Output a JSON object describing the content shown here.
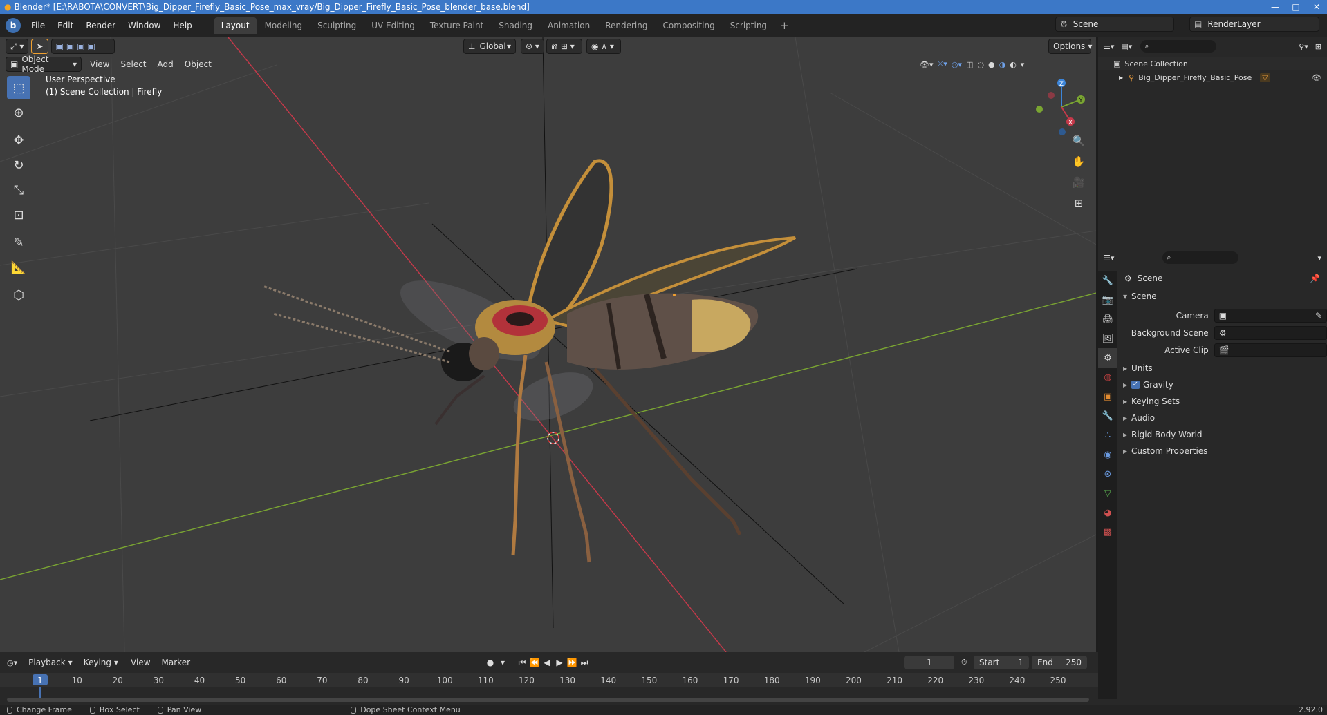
{
  "window": {
    "title": "Blender* [E:\\RABOTA\\CONVERT\\Big_Dipper_Firefly_Basic_Pose_max_vray/Big_Dipper_Firefly_Basic_Pose_blender_base.blend]",
    "minimize": "—",
    "maximize": "□",
    "close": "✕"
  },
  "menu": [
    "File",
    "Edit",
    "Render",
    "Window",
    "Help"
  ],
  "workspaces": [
    "Layout",
    "Modeling",
    "Sculpting",
    "UV Editing",
    "Texture Paint",
    "Shading",
    "Animation",
    "Rendering",
    "Compositing",
    "Scripting"
  ],
  "active_workspace": "Layout",
  "scene_name": "Scene",
  "view_layer": "RenderLayer",
  "viewport": {
    "transform_orientation": "Global",
    "options_label": "Options",
    "mode": "Object Mode",
    "menus": [
      "View",
      "Select",
      "Add",
      "Object"
    ],
    "overlay_line1": "User Perspective",
    "overlay_line2": "(1) Scene Collection | Firefly",
    "gizmo": {
      "x": "X",
      "y": "Y",
      "z": "Z"
    }
  },
  "outliner": {
    "collection": "Scene Collection",
    "object": "Big_Dipper_Firefly_Basic_Pose"
  },
  "properties": {
    "context_title": "Scene",
    "panel_title": "Scene",
    "camera_label": "Camera",
    "bg_scene_label": "Background Scene",
    "active_clip_label": "Active Clip",
    "sections": [
      "Units",
      "Gravity",
      "Keying Sets",
      "Audio",
      "Rigid Body World",
      "Custom Properties"
    ],
    "gravity_checked": true
  },
  "timeline": {
    "menus": [
      "Playback",
      "Keying",
      "View",
      "Marker"
    ],
    "current_frame": "1",
    "start_label": "Start",
    "start_value": "1",
    "end_label": "End",
    "end_value": "250",
    "ruler": [
      "1",
      "10",
      "20",
      "30",
      "40",
      "50",
      "60",
      "70",
      "80",
      "90",
      "100",
      "110",
      "120",
      "130",
      "140",
      "150",
      "160",
      "170",
      "180",
      "190",
      "200",
      "210",
      "220",
      "230",
      "240",
      "250"
    ]
  },
  "statusbar": {
    "change_frame": "Change Frame",
    "box_select": "Box Select",
    "pan_view": "Pan View",
    "context_menu": "Dope Sheet Context Menu",
    "version": "2.92.0"
  },
  "colors": {
    "accent": "#4772b3",
    "x_axis": "#c6394a",
    "y_axis": "#7aa532",
    "z_axis": "#3c85d9",
    "titlebar": "#3c78c7"
  }
}
